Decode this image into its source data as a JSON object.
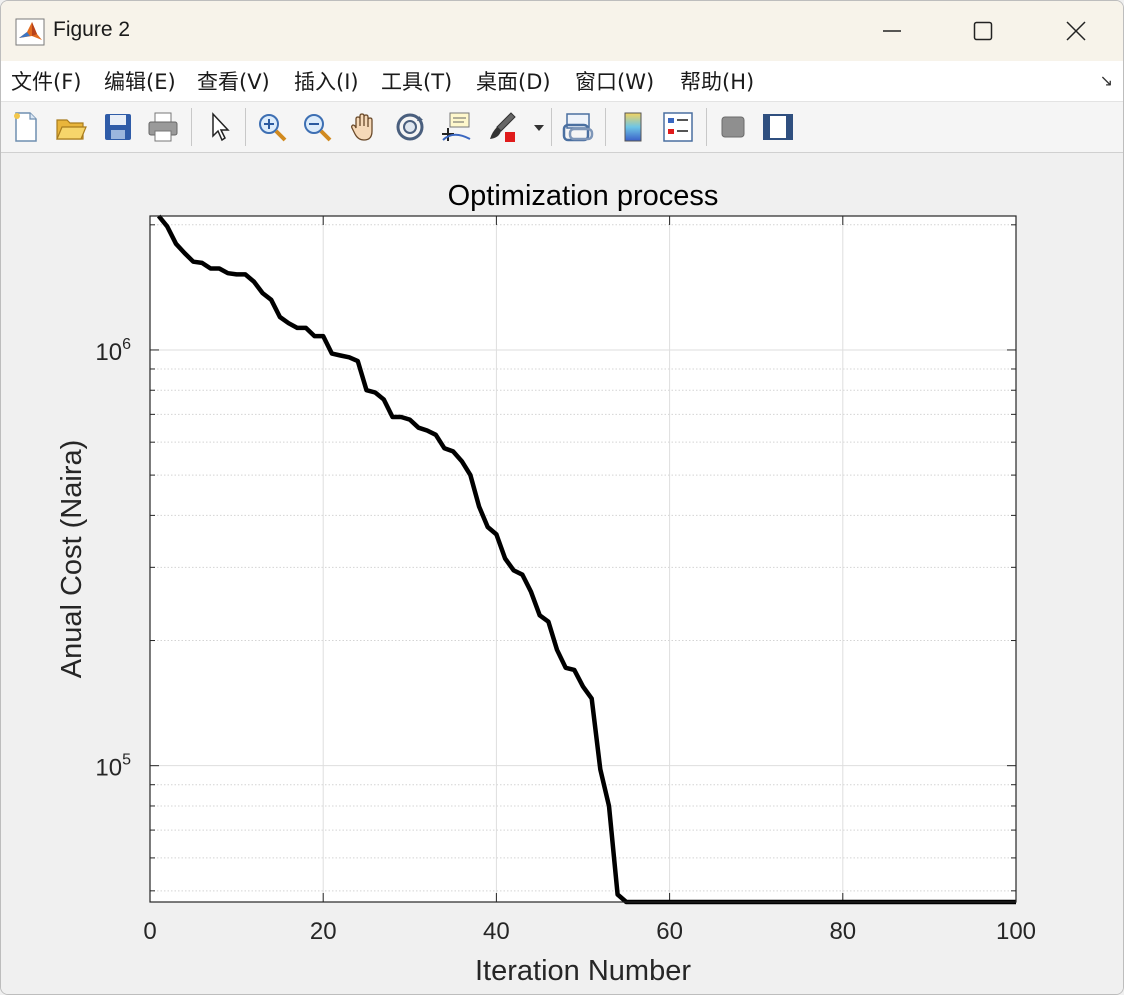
{
  "window": {
    "title": "Figure 2"
  },
  "menu": {
    "items": [
      "文件(F)",
      "编辑(E)",
      "查看(V)",
      "插入(I)",
      "工具(T)",
      "桌面(D)",
      "窗口(W)",
      "帮助(H)"
    ]
  },
  "toolbar": {
    "icons": [
      "new-figure-icon",
      "open-file-icon",
      "save-icon",
      "print-icon",
      "pointer-icon",
      "zoom-in-icon",
      "zoom-out-icon",
      "pan-icon",
      "rotate-3d-icon",
      "data-cursor-icon",
      "brush-icon",
      "link-plot-icon",
      "colorbar-icon",
      "legend-icon",
      "hide-plot-tools-icon",
      "show-plot-tools-icon"
    ]
  },
  "chart_data": {
    "type": "line",
    "title": "Optimization process",
    "xlabel": "Iteration Number",
    "ylabel": "Anual Cost (Naira)",
    "xlim": [
      0,
      100
    ],
    "ylim": [
      47000,
      2100000
    ],
    "yscale": "log",
    "grid": true,
    "xticks": [
      0,
      20,
      40,
      60,
      80,
      100
    ],
    "yticks": [
      {
        "value": 100000,
        "base": "10",
        "exp": "5"
      },
      {
        "value": 1000000,
        "base": "10",
        "exp": "6"
      }
    ],
    "line_color": "#000000",
    "series": [
      {
        "x": [
          1,
          2,
          3,
          4,
          5,
          6,
          7,
          8,
          9,
          10,
          11,
          12,
          13,
          14,
          15,
          16,
          17,
          18,
          19,
          20,
          21,
          22,
          23,
          24,
          25,
          26,
          27,
          28,
          29,
          30,
          31,
          32,
          33,
          34,
          35,
          36,
          37,
          38,
          39,
          40,
          41,
          42,
          43,
          44,
          45,
          46,
          47,
          48,
          49,
          50,
          51,
          52,
          53,
          54,
          55,
          56,
          60,
          70,
          80,
          90,
          100
        ],
        "y": [
          2100000,
          1980000,
          1800000,
          1710000,
          1630000,
          1620000,
          1570000,
          1570000,
          1530000,
          1520000,
          1520000,
          1460000,
          1370000,
          1320000,
          1200000,
          1160000,
          1130000,
          1130000,
          1080000,
          1080000,
          980000,
          970000,
          960000,
          940000,
          800000,
          790000,
          760000,
          690000,
          690000,
          680000,
          650000,
          640000,
          625000,
          580000,
          570000,
          540000,
          500000,
          420000,
          375000,
          360000,
          315000,
          295000,
          288000,
          262000,
          230000,
          222000,
          190000,
          172000,
          170000,
          155000,
          145000,
          98000,
          80000,
          49000,
          47000,
          47000,
          47000,
          47000,
          47000,
          47000,
          47000
        ]
      }
    ]
  }
}
